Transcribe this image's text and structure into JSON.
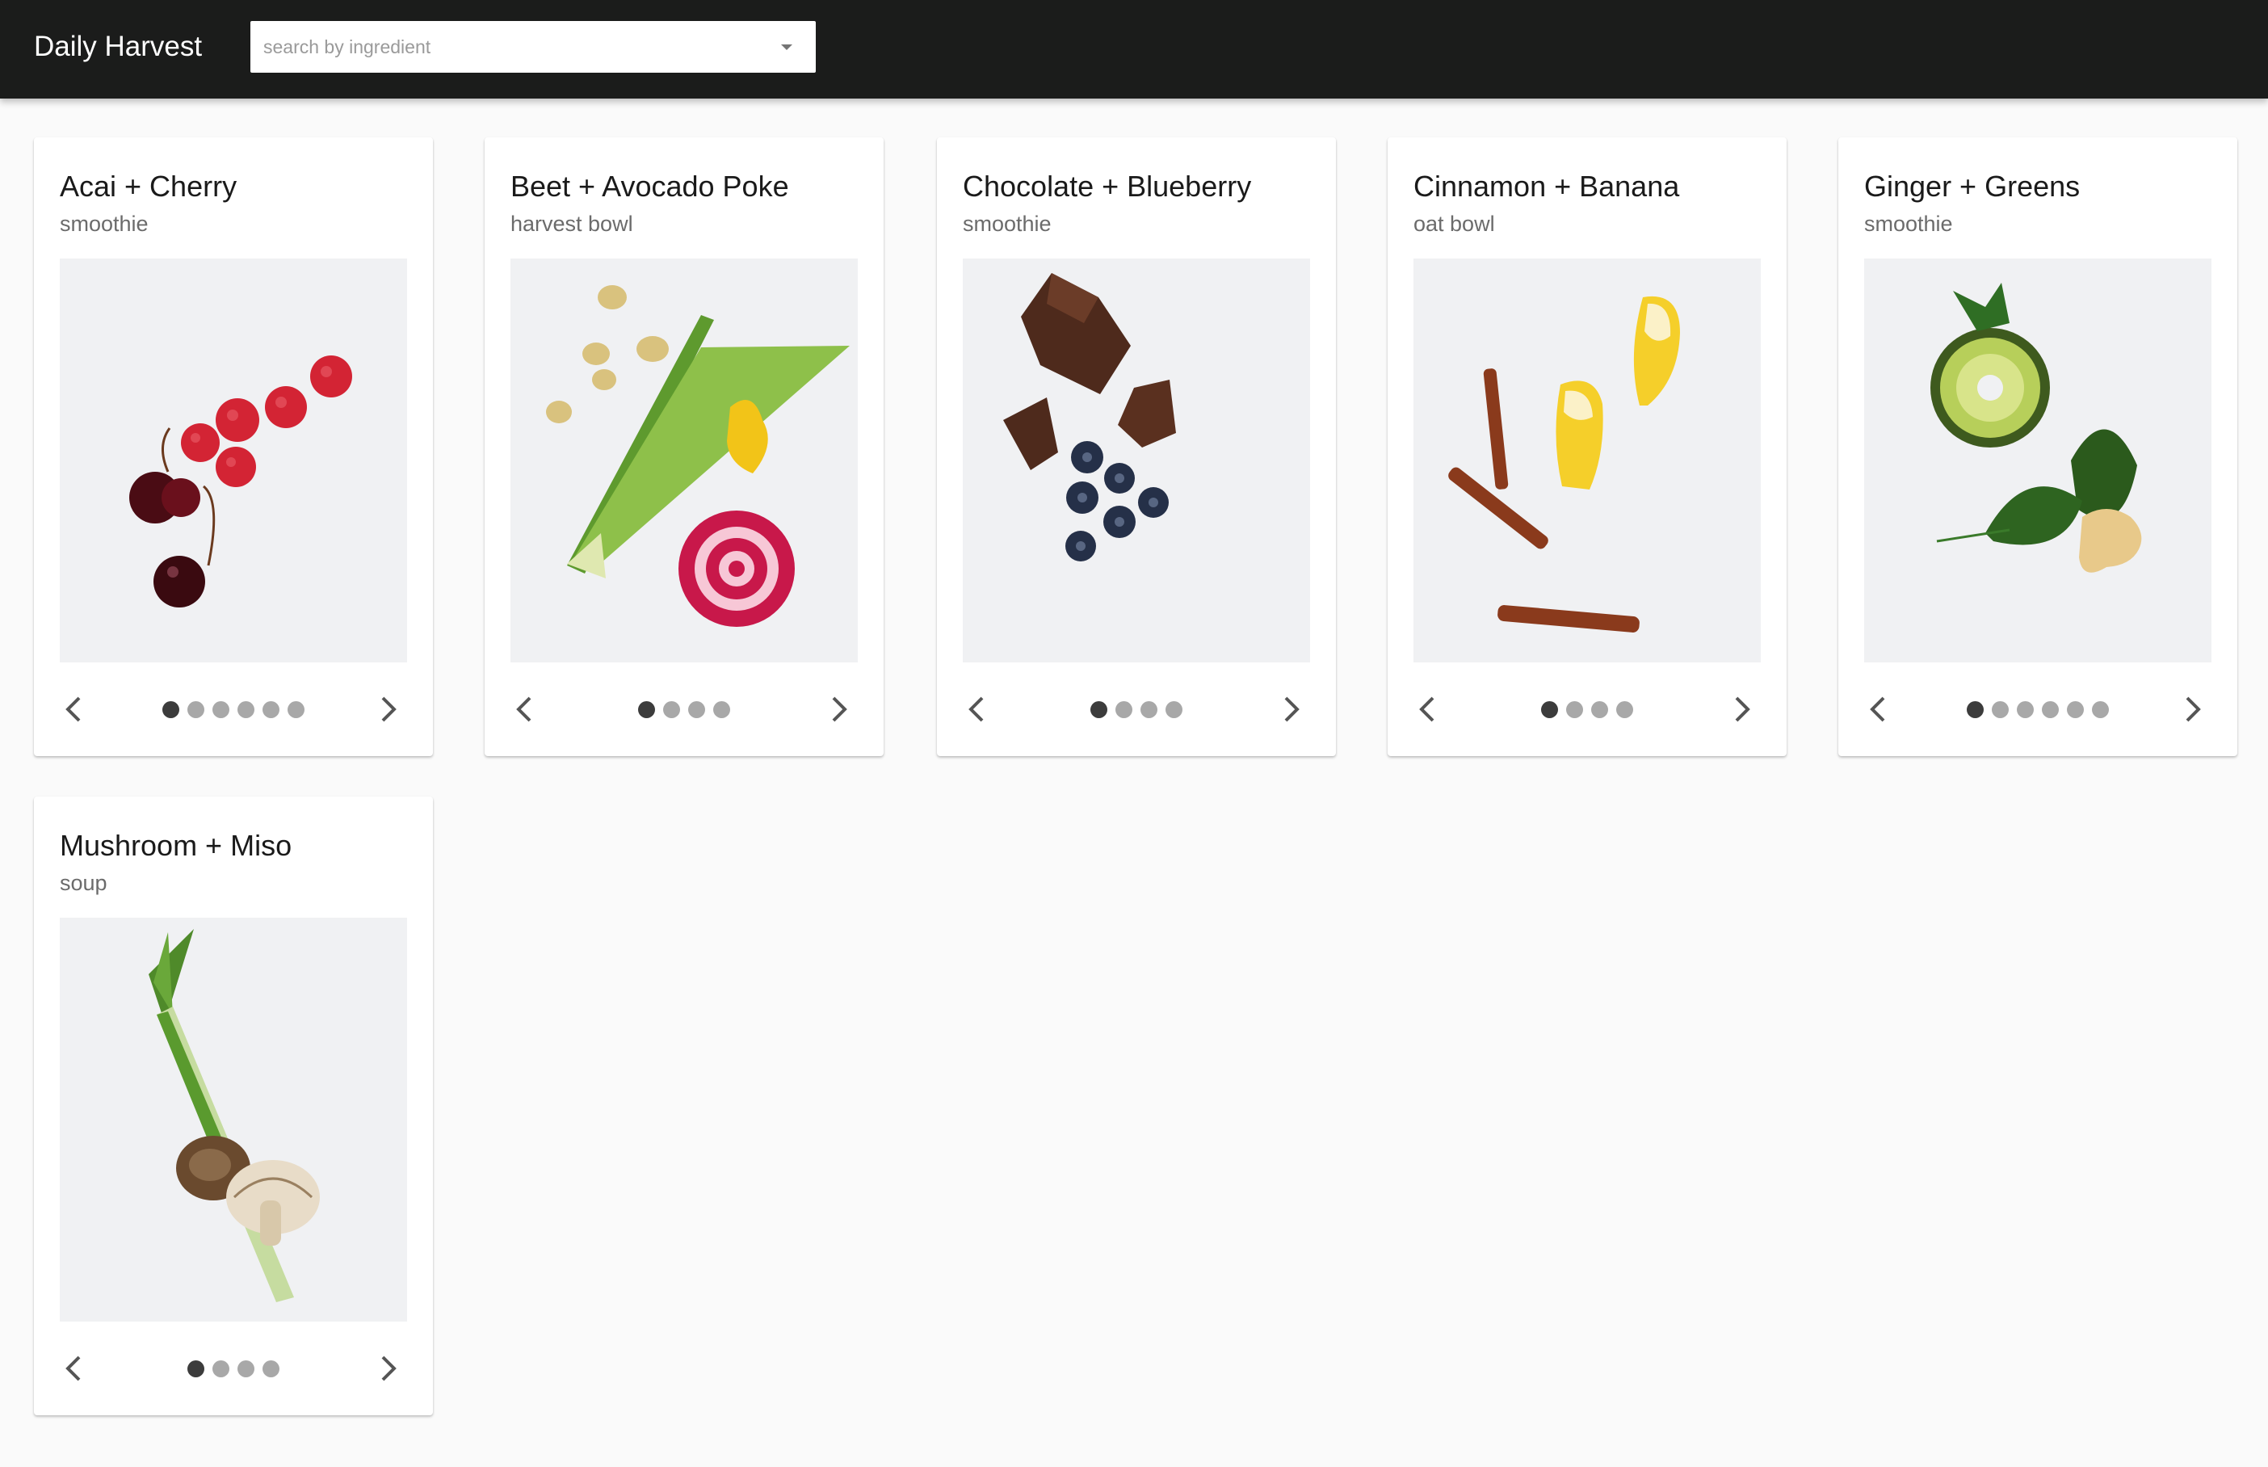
{
  "app": {
    "title": "Daily Harvest"
  },
  "search": {
    "placeholder": "search by ingredient",
    "value": ""
  },
  "cards": [
    {
      "title": "Acai + Cherry",
      "subtitle": "smoothie",
      "image": "cherries-raspberries",
      "slides": 6,
      "active_slide": 1
    },
    {
      "title": "Beet + Avocado Poke",
      "subtitle": "harvest bowl",
      "image": "scallion-beet-ginger-macadamia",
      "slides": 4,
      "active_slide": 1
    },
    {
      "title": "Chocolate + Blueberry",
      "subtitle": "smoothie",
      "image": "chocolate-blueberries",
      "slides": 4,
      "active_slide": 1
    },
    {
      "title": "Cinnamon + Banana",
      "subtitle": "oat bowl",
      "image": "cinnamon-banana",
      "slides": 4,
      "active_slide": 1
    },
    {
      "title": "Ginger + Greens",
      "subtitle": "smoothie",
      "image": "avocado-spinach-ginger",
      "slides": 6,
      "active_slide": 1
    },
    {
      "title": "Mushroom + Miso",
      "subtitle": "soup",
      "image": "shiitake-scallion",
      "slides": 4,
      "active_slide": 1
    }
  ],
  "icons": {
    "prev": "chevron-left-icon",
    "next": "chevron-right-icon",
    "dropdown": "caret-down-icon"
  },
  "colors": {
    "topbar": "#1b1c1b",
    "background": "#fafafa",
    "dot_active": "#3c3c3c",
    "dot_inactive": "#a8a8a8"
  }
}
